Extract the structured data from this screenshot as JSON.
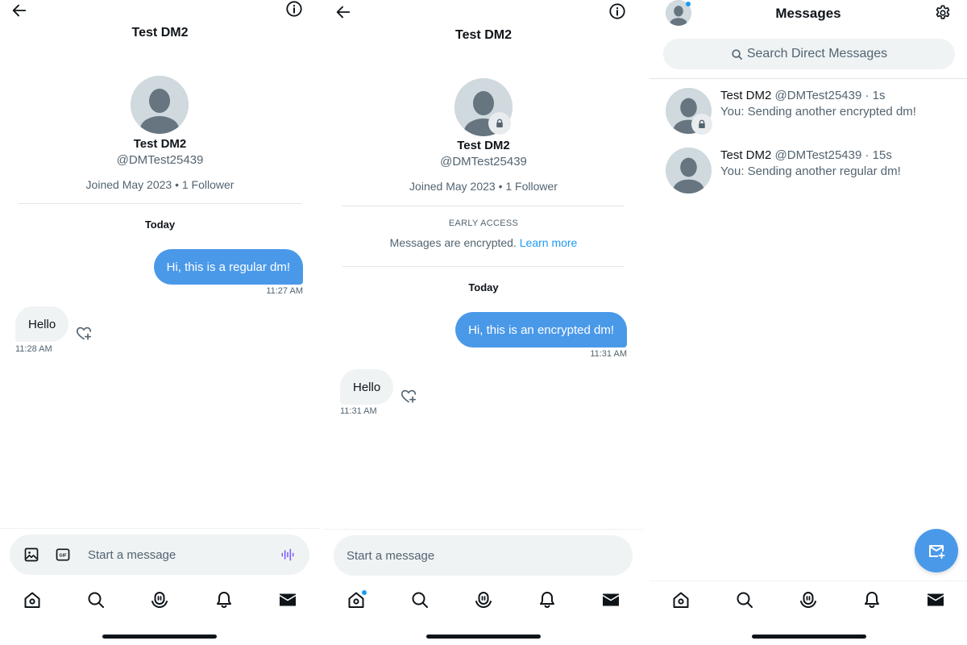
{
  "colors": {
    "accent": "#1d9bf0",
    "bubble_out": "#4a99e9",
    "bubble_in": "#eff3f4",
    "muted": "#536471",
    "voice": "#7856ff"
  },
  "regular_chat": {
    "title": "Test DM2",
    "profile": {
      "name": "Test DM2",
      "handle": "@DMTest25439",
      "joined": "Joined May 2023 • 1 Follower"
    },
    "date_label": "Today",
    "messages": [
      {
        "direction": "out",
        "text": "Hi, this is a regular dm!",
        "time": "11:27 AM"
      },
      {
        "direction": "in",
        "text": "Hello",
        "time": "11:28 AM"
      }
    ],
    "composer": {
      "placeholder": "Start a message",
      "icons": [
        "image-icon",
        "gif-icon",
        "voice-icon"
      ]
    }
  },
  "encrypted_chat": {
    "title": "Test DM2",
    "profile": {
      "name": "Test DM2",
      "handle": "@DMTest25439",
      "joined": "Joined May 2023 • 1 Follower",
      "badge": "lock-icon"
    },
    "notice": {
      "tag": "EARLY ACCESS",
      "text": "Messages are encrypted.",
      "link": "Learn more"
    },
    "date_label": "Today",
    "messages": [
      {
        "direction": "out",
        "text": "Hi, this is an encrypted dm!",
        "time": "11:31 AM"
      },
      {
        "direction": "in",
        "text": "Hello",
        "time": "11:31 AM"
      }
    ],
    "composer": {
      "placeholder": "Start a message"
    }
  },
  "inbox": {
    "title": "Messages",
    "search_placeholder": "Search Direct Messages",
    "conversations": [
      {
        "name": "Test DM2",
        "handle": "@DMTest25439",
        "age": "1s",
        "preview": "You: Sending another encrypted dm!",
        "encrypted": true
      },
      {
        "name": "Test DM2",
        "handle": "@DMTest25439",
        "age": "15s",
        "preview": "You: Sending another regular dm!",
        "encrypted": false
      }
    ]
  },
  "tabbar": [
    "home-icon",
    "search-icon",
    "spaces-icon",
    "notifications-icon",
    "messages-icon"
  ]
}
